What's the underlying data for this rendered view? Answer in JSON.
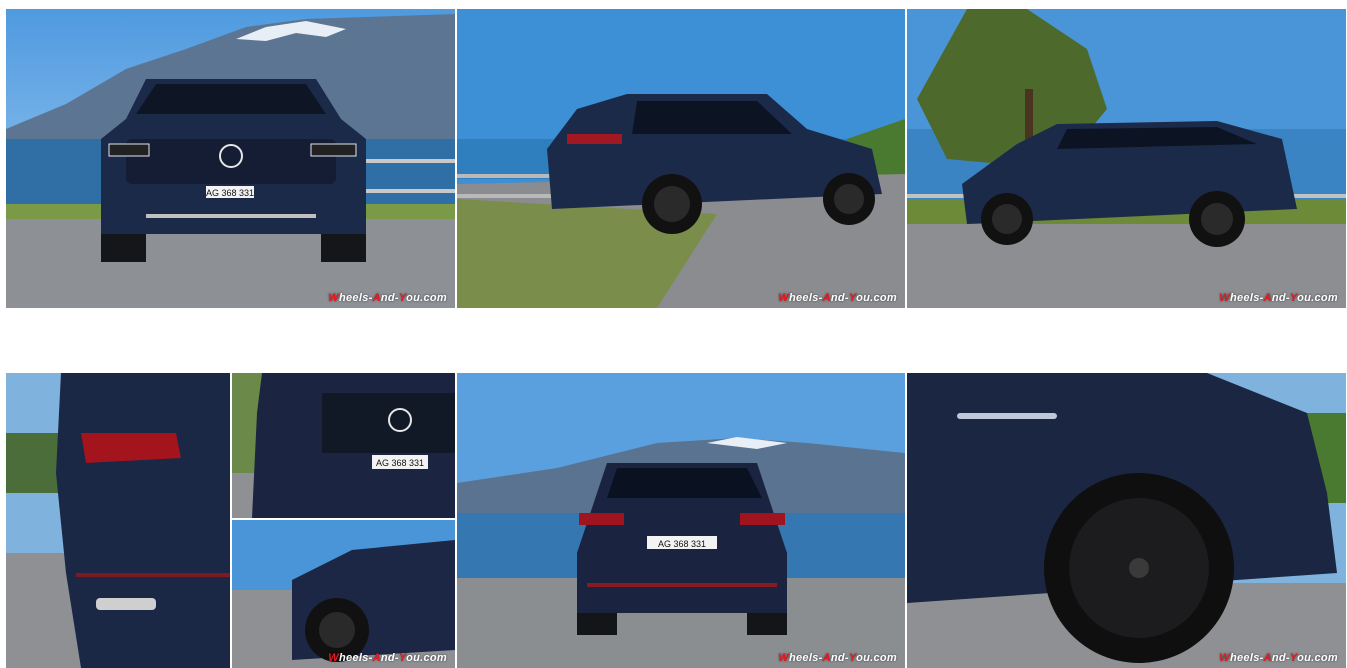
{
  "gallery": {
    "watermark": {
      "w1": "W",
      "part1": "heels-",
      "w2": "A",
      "part2": "nd-",
      "w3": "Y",
      "part3": "ou.com"
    },
    "plates": {
      "front": "AG 368 331",
      "front_detail": "AG 368 331",
      "rear": "AG 368 331"
    },
    "colors": {
      "sky": "#3d8fd6",
      "car_body": "#1c2a4a",
      "asphalt": "#7d7f82",
      "grass": "#6e8a3a",
      "watermark_accent": "#e11b22"
    }
  }
}
